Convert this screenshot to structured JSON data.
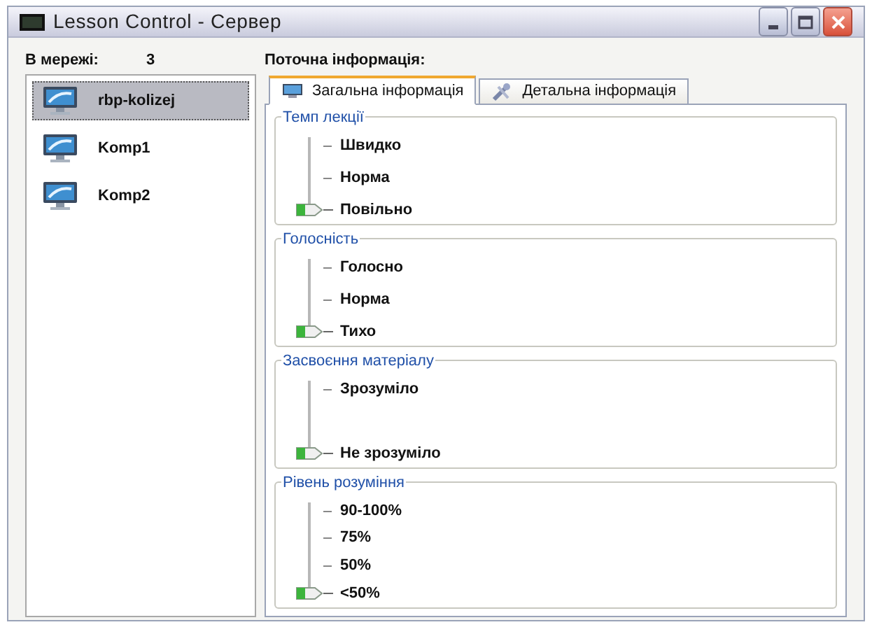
{
  "window": {
    "title": "Lesson Control - Сервер"
  },
  "network": {
    "label": "В мережі:",
    "count": "3"
  },
  "computers": [
    {
      "name": "rbp-kolizej",
      "selected": true
    },
    {
      "name": "Komp1",
      "selected": false
    },
    {
      "name": "Komp2",
      "selected": false
    }
  ],
  "info_label": "Поточна інформація:",
  "tabs": [
    {
      "label": "Загальна інформація",
      "selected": true
    },
    {
      "label": "Детальна інформація",
      "selected": false
    }
  ],
  "groups": [
    {
      "title": "Темп лекції",
      "options": [
        {
          "label": "Швидко",
          "selected": false
        },
        {
          "label": "Норма",
          "selected": false
        },
        {
          "label": "Повільно",
          "selected": true
        }
      ]
    },
    {
      "title": "Голосність",
      "options": [
        {
          "label": "Голосно",
          "selected": false
        },
        {
          "label": "Норма",
          "selected": false
        },
        {
          "label": "Тихо",
          "selected": true
        }
      ]
    },
    {
      "title": "Засвоєння матеріалу",
      "options": [
        {
          "label": "Зрозуміло",
          "selected": false
        },
        {
          "label": "Не зрозуміло",
          "selected": true
        }
      ]
    },
    {
      "title": "Рівень розуміння",
      "options": [
        {
          "label": "90-100%",
          "selected": false
        },
        {
          "label": "75%",
          "selected": false
        },
        {
          "label": "50%",
          "selected": false
        },
        {
          "label": "<50%",
          "selected": true
        }
      ]
    }
  ]
}
